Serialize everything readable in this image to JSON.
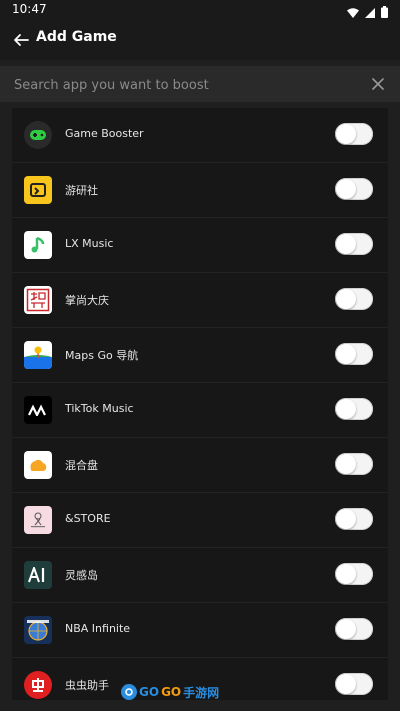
{
  "status_bar": {
    "time": "10:47",
    "icons": [
      "wifi-icon",
      "signal-icon",
      "battery-icon"
    ]
  },
  "header": {
    "title": "Add Game",
    "back_icon": "arrow-left-icon"
  },
  "search": {
    "placeholder": "Search app you want to boost",
    "value": "",
    "clear_icon": "close-icon"
  },
  "apps": [
    {
      "name": "Game Booster",
      "icon": "game-booster-icon",
      "enabled": false
    },
    {
      "name": "游研社",
      "icon": "youyanshe-icon",
      "enabled": false
    },
    {
      "name": "LX Music",
      "icon": "lx-music-icon",
      "enabled": false
    },
    {
      "name": "掌尚大庆",
      "icon": "zhangshang-daqing-icon",
      "enabled": false
    },
    {
      "name": "Maps Go 导航",
      "icon": "maps-go-icon",
      "enabled": false
    },
    {
      "name": "TikTok Music",
      "icon": "tiktok-music-icon",
      "enabled": false
    },
    {
      "name": "混合盘",
      "icon": "hunhepan-icon",
      "enabled": false
    },
    {
      "name": "&STORE",
      "icon": "and-store-icon",
      "enabled": false
    },
    {
      "name": "灵感岛",
      "icon": "linggandao-icon",
      "enabled": false
    },
    {
      "name": "NBA Infinite",
      "icon": "nba-infinite-icon",
      "enabled": false
    },
    {
      "name": "虫虫助手",
      "icon": "chongchong-zhushou-icon",
      "enabled": false
    }
  ],
  "watermark": {
    "text_go1": "GO",
    "text_go2": "GO",
    "text_cn": "手游网"
  },
  "colors": {
    "background": "#1f1f1f",
    "list_background": "#171717",
    "accent_green": "#2ecc40"
  }
}
